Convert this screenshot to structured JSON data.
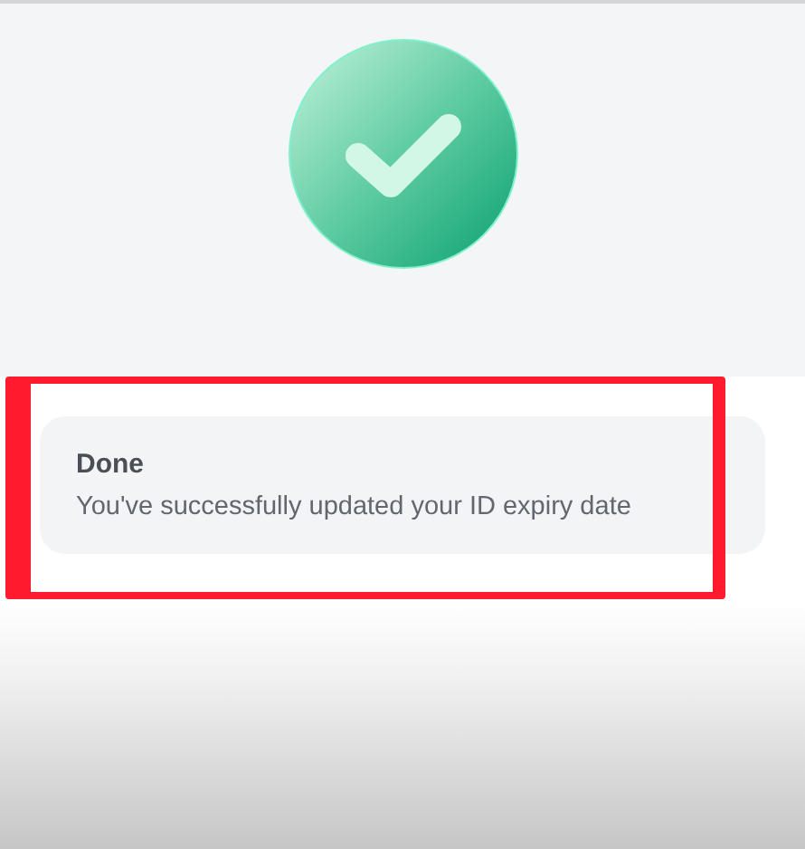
{
  "status": {
    "kind": "success"
  },
  "message_card": {
    "title": "Done",
    "message": "You've successfully updated your ID expiry date",
    "highlighted": true
  }
}
